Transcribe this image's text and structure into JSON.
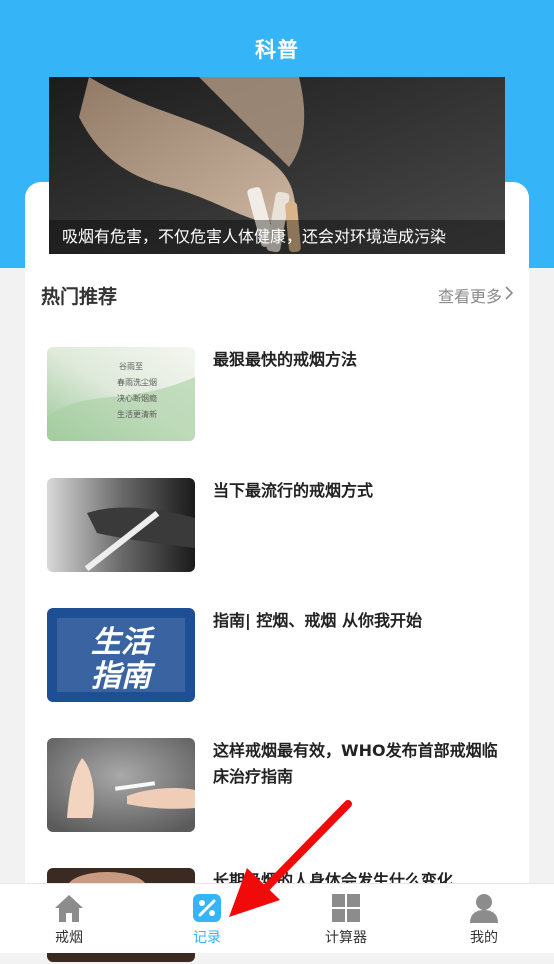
{
  "header": {
    "title": "科普"
  },
  "banner": {
    "caption": "吸烟有危害，不仅危害人体健康，还会对环境造成污染"
  },
  "hot": {
    "title": "热门推荐",
    "more_label": "查看更多",
    "more_icon": "chevron-right-icon"
  },
  "articles": [
    {
      "title": "最狠最快的戒烟方法",
      "thumb_text": [
        "谷雨至",
        "春雨洗尘烟",
        "决心断烟瘾",
        "生活更清新"
      ]
    },
    {
      "title": "当下最流行的戒烟方式"
    },
    {
      "title": "指南| 控烟、戒烟 从你我开始",
      "thumb_text": [
        "生活",
        "指南"
      ]
    },
    {
      "title": "这样戒烟最有效，WHO发布首部戒烟临床治疗指南"
    },
    {
      "title": "长期吸烟的人身体会发生什么变化"
    }
  ],
  "tabbar": {
    "tabs": [
      {
        "label": "戒烟",
        "icon": "home-icon"
      },
      {
        "label": "记录",
        "icon": "record-icon",
        "active": true
      },
      {
        "label": "计算器",
        "icon": "grid-icon"
      },
      {
        "label": "我的",
        "icon": "person-icon"
      }
    ]
  },
  "colors": {
    "accent": "#35b4f7",
    "annotation_arrow": "#f00a0a"
  }
}
